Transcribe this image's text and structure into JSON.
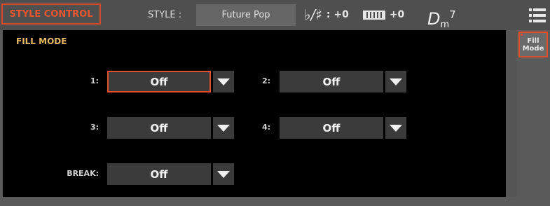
{
  "header": {
    "page_title": "STYLE CONTROL",
    "style_label": "STYLE :",
    "style_name": "Future Pop",
    "transpose_glyph": "♭/♯",
    "transpose_value": ": +0",
    "octave_value": "+0",
    "chord_root": "D",
    "chord_quality": "m",
    "chord_extension": "7",
    "menu_icon": "hamburger-menu-icon"
  },
  "panel": {
    "title": "FILL MODE",
    "fields": [
      {
        "label": "1:",
        "value": "Off"
      },
      {
        "label": "2:",
        "value": "Off"
      },
      {
        "label": "3:",
        "value": "Off"
      },
      {
        "label": "4:",
        "value": "Off"
      },
      {
        "label": "BREAK:",
        "value": "Off"
      }
    ]
  },
  "side_tabs": [
    {
      "line1": "Fill",
      "line2": "Mode"
    }
  ],
  "colors": {
    "accent": "#e0502d",
    "panel_title": "#e7b864"
  }
}
